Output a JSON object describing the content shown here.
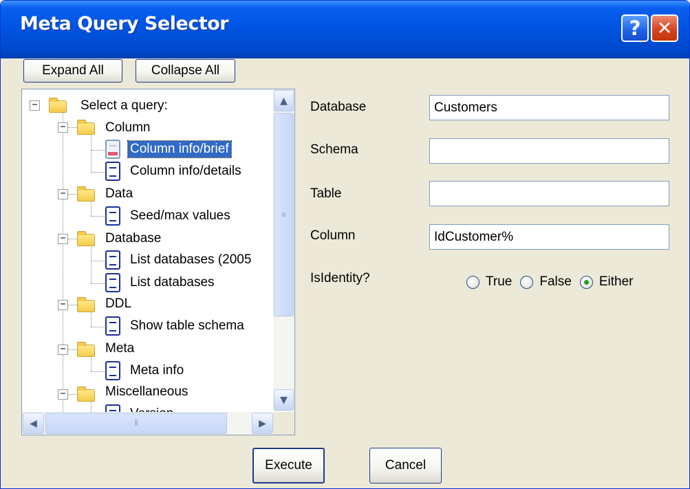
{
  "window": {
    "title": "Meta Query Selector",
    "help_glyph": "?",
    "close_glyph": "✕"
  },
  "toolbar": {
    "expand_all": "Expand All",
    "collapse_all": "Collapse All"
  },
  "tree": {
    "root": "Select a query:",
    "groups": [
      {
        "label": "Column",
        "items": [
          "Column info/brief",
          "Column info/details"
        ]
      },
      {
        "label": "Data",
        "items": [
          "Seed/max values"
        ]
      },
      {
        "label": "Database",
        "items": [
          "List databases (2005",
          "List databases"
        ]
      },
      {
        "label": "DDL",
        "items": [
          "Show table schema"
        ]
      },
      {
        "label": "Meta",
        "items": [
          "Meta info"
        ]
      },
      {
        "label": "Miscellaneous",
        "items": [
          "Version"
        ]
      }
    ],
    "selected_item": "Column info/brief",
    "scroll_glyphs": {
      "up": "▲",
      "down": "▼",
      "left": "◀",
      "right": "▶",
      "thumb_v": "≡",
      "thumb_h": "⦀"
    }
  },
  "form": {
    "database": {
      "label": "Database",
      "value": "Customers"
    },
    "schema": {
      "label": "Schema",
      "value": ""
    },
    "table": {
      "label": "Table",
      "value": ""
    },
    "column": {
      "label": "Column",
      "value": "IdCustomer%"
    },
    "is_identity": {
      "label": "IsIdentity?",
      "options": [
        "True",
        "False",
        "Either"
      ],
      "selected": "Either"
    }
  },
  "footer": {
    "execute": "Execute",
    "cancel": "Cancel"
  },
  "colors": {
    "title_bar": "#0054e3",
    "selection": "#316ac5",
    "window_bg": "#ece9d8"
  }
}
